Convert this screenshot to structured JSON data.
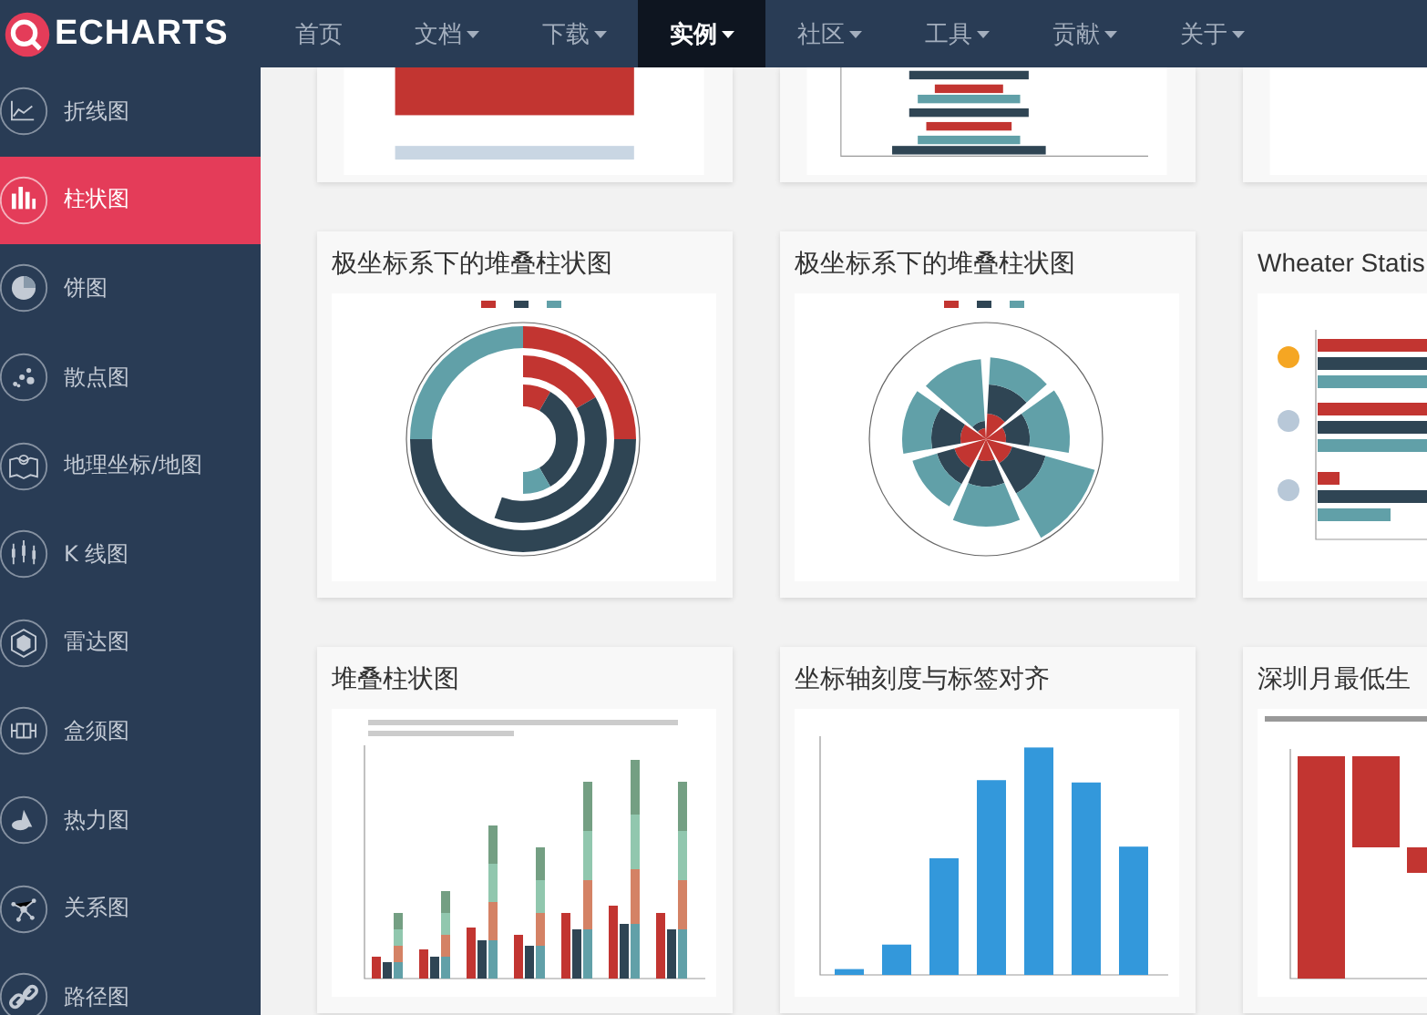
{
  "logo": {
    "text": "ECHARTS"
  },
  "nav": [
    {
      "label": "首页",
      "dropdown": false,
      "selected": false
    },
    {
      "label": "文档",
      "dropdown": true,
      "selected": false
    },
    {
      "label": "下载",
      "dropdown": true,
      "selected": false
    },
    {
      "label": "实例",
      "dropdown": true,
      "selected": true
    },
    {
      "label": "社区",
      "dropdown": true,
      "selected": false
    },
    {
      "label": "工具",
      "dropdown": true,
      "selected": false
    },
    {
      "label": "贡献",
      "dropdown": true,
      "selected": false
    },
    {
      "label": "关于",
      "dropdown": true,
      "selected": false
    }
  ],
  "sidebar": {
    "items": [
      {
        "label": "折线图",
        "kind": "line",
        "selected": false
      },
      {
        "label": "柱状图",
        "kind": "bar",
        "selected": true
      },
      {
        "label": "饼图",
        "kind": "pie",
        "selected": false
      },
      {
        "label": "散点图",
        "kind": "scatter",
        "selected": false
      },
      {
        "label": "地理坐标/地图",
        "kind": "map",
        "selected": false
      },
      {
        "label": "K 线图",
        "kind": "candlestick",
        "selected": false
      },
      {
        "label": "雷达图",
        "kind": "radar",
        "selected": false
      },
      {
        "label": "盒须图",
        "kind": "boxplot",
        "selected": false
      },
      {
        "label": "热力图",
        "kind": "heatmap",
        "selected": false
      },
      {
        "label": "关系图",
        "kind": "graph",
        "selected": false
      },
      {
        "label": "路径图",
        "kind": "link",
        "selected": false
      }
    ]
  },
  "gallery": {
    "rows": [
      {
        "cards": [
          {
            "kind": "area"
          },
          {
            "kind": "hbar"
          },
          {
            "kind": "hbarright"
          }
        ]
      },
      {
        "cards": [
          {
            "title": "极坐标系下的堆叠柱状图",
            "kind": "polarring"
          },
          {
            "title": "极坐标系下的堆叠柱状图",
            "kind": "polarrose"
          },
          {
            "title": "Wheater Statis",
            "kind": "weather"
          }
        ]
      },
      {
        "cards": [
          {
            "title": "堆叠柱状图",
            "kind": "stacked"
          },
          {
            "title": "坐标轴刻度与标签对齐",
            "kind": "column"
          },
          {
            "title": "深圳月最低生",
            "kind": "waterfall"
          }
        ]
      }
    ]
  }
}
